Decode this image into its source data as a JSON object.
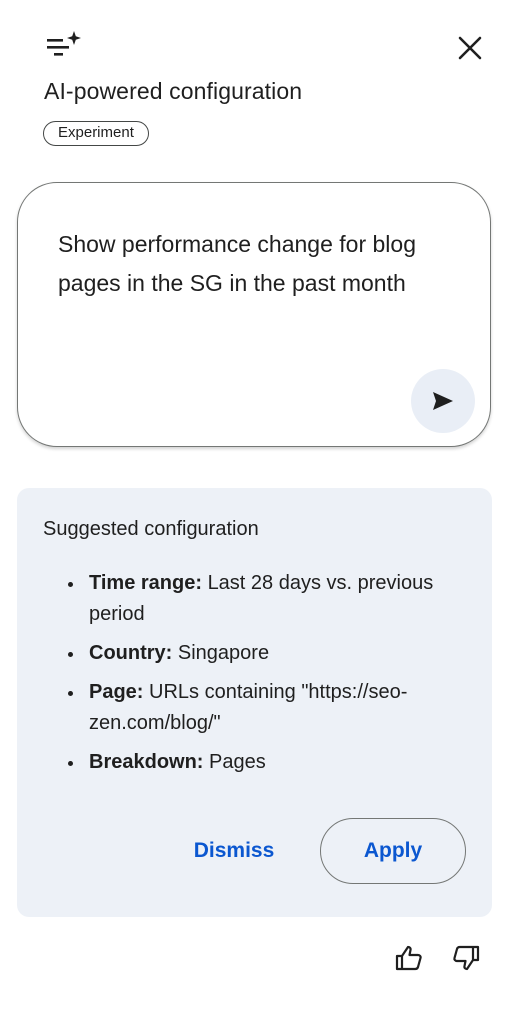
{
  "header": {
    "icon": "tune-sparkle-icon",
    "close_icon": "close-icon",
    "title": "AI-powered configuration",
    "badge": "Experiment"
  },
  "prompt": {
    "text": "Show performance change for blog pages in the SG in the past month",
    "send_icon": "send-icon"
  },
  "suggestion": {
    "title": "Suggested configuration",
    "items": [
      {
        "key": "Time range:",
        "value": "Last 28 days vs. previous period"
      },
      {
        "key": "Country:",
        "value": "Singapore"
      },
      {
        "key": "Page:",
        "value": "URLs containing \"https://seo-zen.com/blog/\""
      },
      {
        "key": "Breakdown:",
        "value": "Pages"
      }
    ],
    "dismiss_label": "Dismiss",
    "apply_label": "Apply"
  },
  "feedback": {
    "thumbs_up_icon": "thumbs-up-icon",
    "thumbs_down_icon": "thumbs-down-icon"
  },
  "colors": {
    "accent": "#0b57d0",
    "card_bg": "#edf1f7",
    "send_bg": "#e9eef6"
  }
}
